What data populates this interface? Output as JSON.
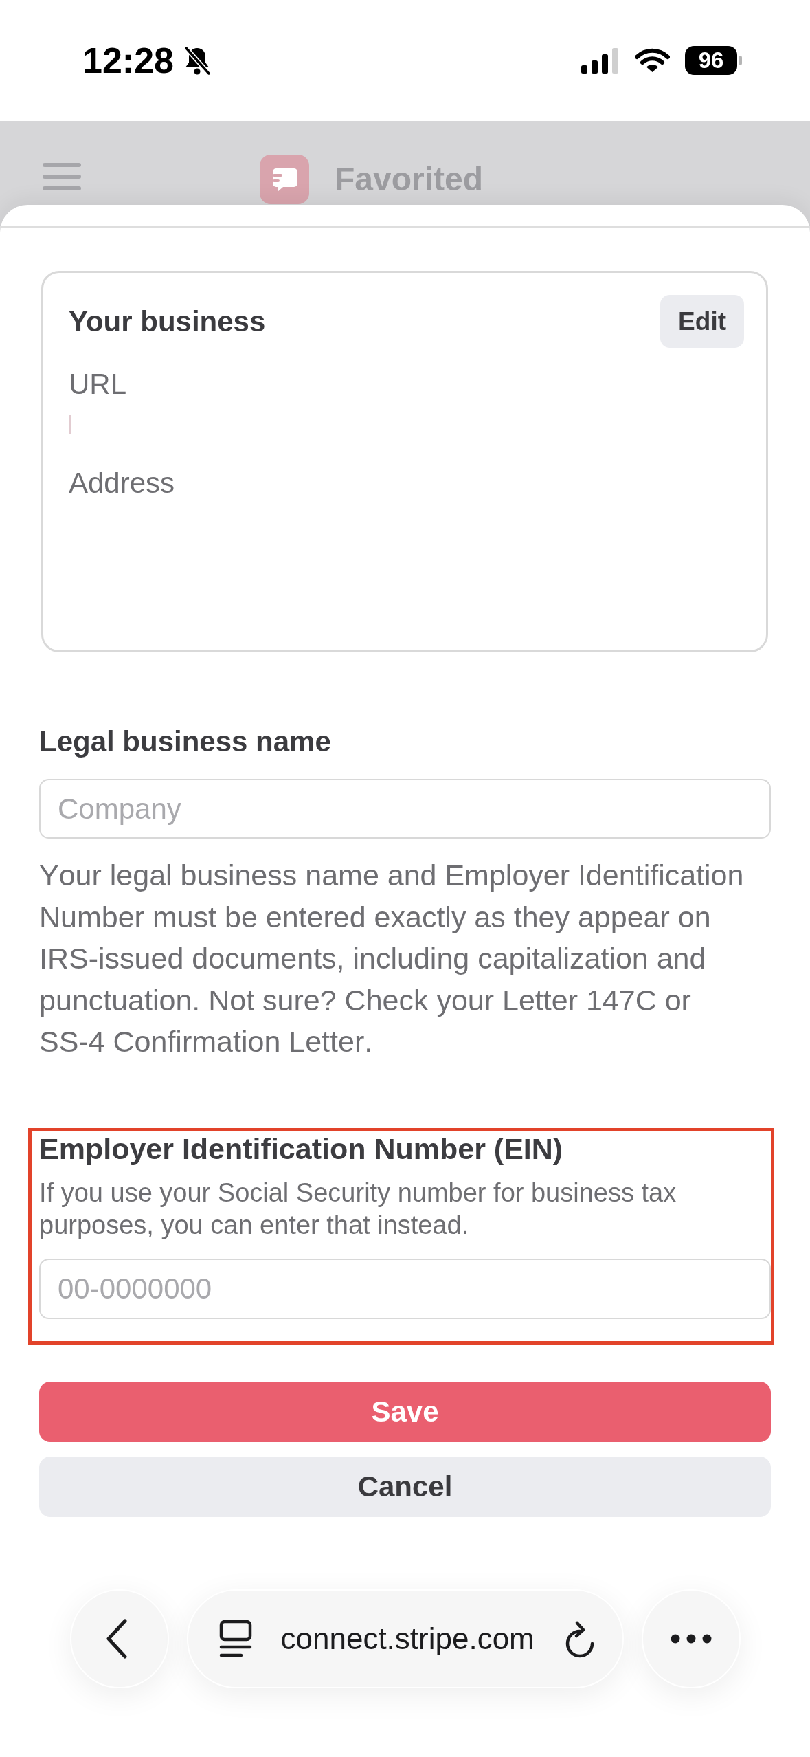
{
  "status_bar": {
    "time": "12:28",
    "silent": true,
    "battery": "96"
  },
  "header": {
    "title": "Favorited"
  },
  "business_card": {
    "title": "Your business",
    "edit_button": "Edit",
    "fields": [
      {
        "label": "URL",
        "cursor": true
      },
      {
        "label": "Address",
        "cursor": false
      }
    ]
  },
  "legal_name": {
    "label": "Legal business name",
    "placeholder": "Company",
    "help": "Your legal business name and Employer Identification Number must be entered exactly as they appear on IRS-issued documents, including capitalization and punctuation. Not sure? Check your Letter 147C or SS-4 Confirmation Letter."
  },
  "ein": {
    "label": "Employer Identification Number (EIN)",
    "help": "If you use your Social Security number for business tax purposes, you can enter that instead.",
    "placeholder": "00-0000000",
    "highlighted": true
  },
  "buttons": [
    {
      "label": "Save",
      "kind": "primary"
    },
    {
      "label": "Cancel",
      "kind": "secondary"
    }
  ],
  "browser_bar": {
    "url": "connect.stripe.com"
  }
}
